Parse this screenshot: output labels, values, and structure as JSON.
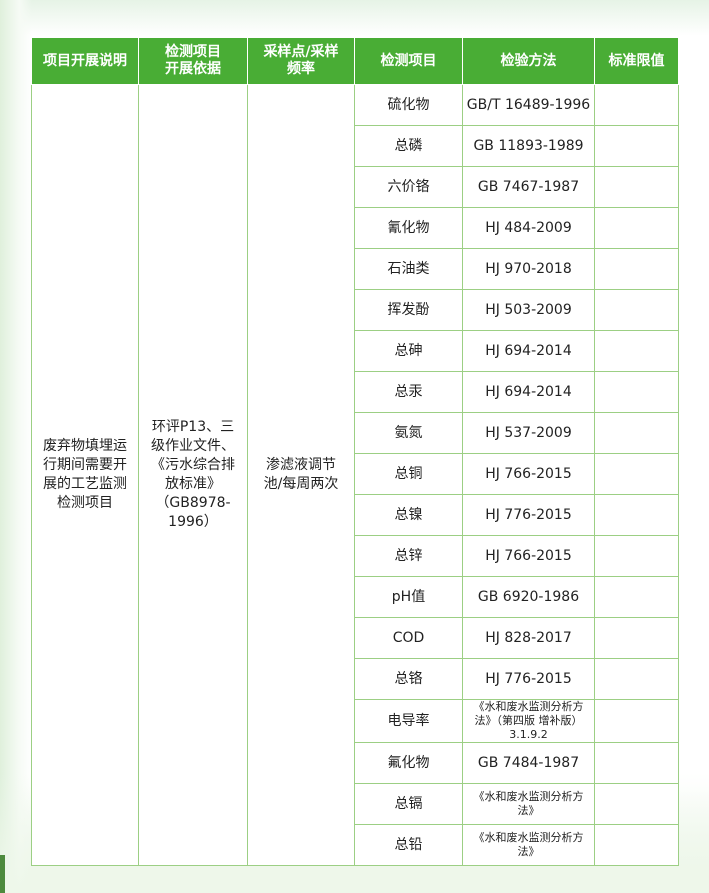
{
  "table": {
    "headers": [
      "项目开展说明",
      "检测项目\n开展依据",
      "采样点/采样\n频率",
      "检测项目",
      "检验方法",
      "标准限值"
    ],
    "description": "废弃物填埋运行期间需要开展的工艺监测检测项目",
    "basis": "环评P13、三级作业文件、《污水综合排放标准》（GB8978-1996）",
    "sampling": "渗滤液调节池/每周两次",
    "rows": [
      {
        "item": "硫化物",
        "method": "GB/T 16489-1996",
        "limit": ""
      },
      {
        "item": "总磷",
        "method": "GB 11893-1989",
        "limit": ""
      },
      {
        "item": "六价铬",
        "method": "GB 7467-1987",
        "limit": ""
      },
      {
        "item": "氰化物",
        "method": "HJ 484-2009",
        "limit": ""
      },
      {
        "item": "石油类",
        "method": "HJ 970-2018",
        "limit": ""
      },
      {
        "item": "挥发酚",
        "method": "HJ 503-2009",
        "limit": ""
      },
      {
        "item": "总砷",
        "method": "HJ 694-2014",
        "limit": ""
      },
      {
        "item": "总汞",
        "method": "HJ 694-2014",
        "limit": ""
      },
      {
        "item": "氨氮",
        "method": "HJ 537-2009",
        "limit": ""
      },
      {
        "item": "总铜",
        "method": "HJ 766-2015",
        "limit": ""
      },
      {
        "item": "总镍",
        "method": "HJ 776-2015",
        "limit": ""
      },
      {
        "item": "总锌",
        "method": "HJ 766-2015",
        "limit": ""
      },
      {
        "item": "pH值",
        "method": "GB 6920-1986",
        "limit": ""
      },
      {
        "item": "COD",
        "method": "HJ 828-2017",
        "limit": ""
      },
      {
        "item": "总铬",
        "method": "HJ 776-2015",
        "limit": ""
      },
      {
        "item": "电导率",
        "method": "《水和废水监测分析方法》（第四版 增补版）3.1.9.2",
        "limit": "",
        "small": true
      },
      {
        "item": "氟化物",
        "method": "GB 7484-1987",
        "limit": ""
      },
      {
        "item": "总镉",
        "method": "《水和废水监测分析方法》",
        "limit": "",
        "small": true
      },
      {
        "item": "总铅",
        "method": "《水和废水监测分析方法》",
        "limit": "",
        "small": true
      }
    ]
  }
}
